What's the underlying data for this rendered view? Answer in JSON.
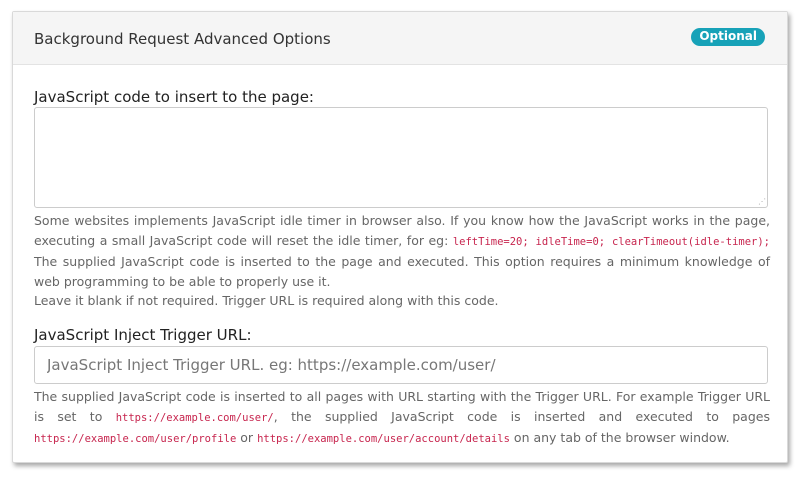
{
  "panel": {
    "title": "Background Request Advanced Options",
    "badge": "Optional"
  },
  "js_code": {
    "label": "JavaScript code to insert to the page:",
    "value": "",
    "help_part1": "Some websites implements JavaScript idle timer in browser also. If you know how the JavaScript works in the page, executing a small JavaScript code will reset the idle timer, for eg:",
    "help_code": "leftTime=20; idleTime=0; clearTimeout(idle-timer);",
    "help_part2": "The supplied JavaScript code is inserted to the page and executed. This option requires a minimum knowledge of web programming to be able to properly use it.",
    "help_line2": "Leave it blank if not required. Trigger URL is required along with this code."
  },
  "trigger_url": {
    "label": "JavaScript Inject Trigger URL:",
    "placeholder": "JavaScript Inject Trigger URL. eg: https://example.com/user/",
    "value": "",
    "help_part1": "The supplied JavaScript code is inserted to all pages with URL starting with the Trigger URL. For example Trigger URL is set to",
    "help_code1": "https://example.com/user/",
    "help_part2": ", the supplied JavaScript code is inserted and executed to pages",
    "help_code2": "https://example.com/user/profile",
    "help_part3": "or",
    "help_code3": "https://example.com/user/account/details",
    "help_part4": "on any tab of the browser window."
  },
  "colors": {
    "badge": "#17a2b8",
    "code": "#c7254e"
  }
}
